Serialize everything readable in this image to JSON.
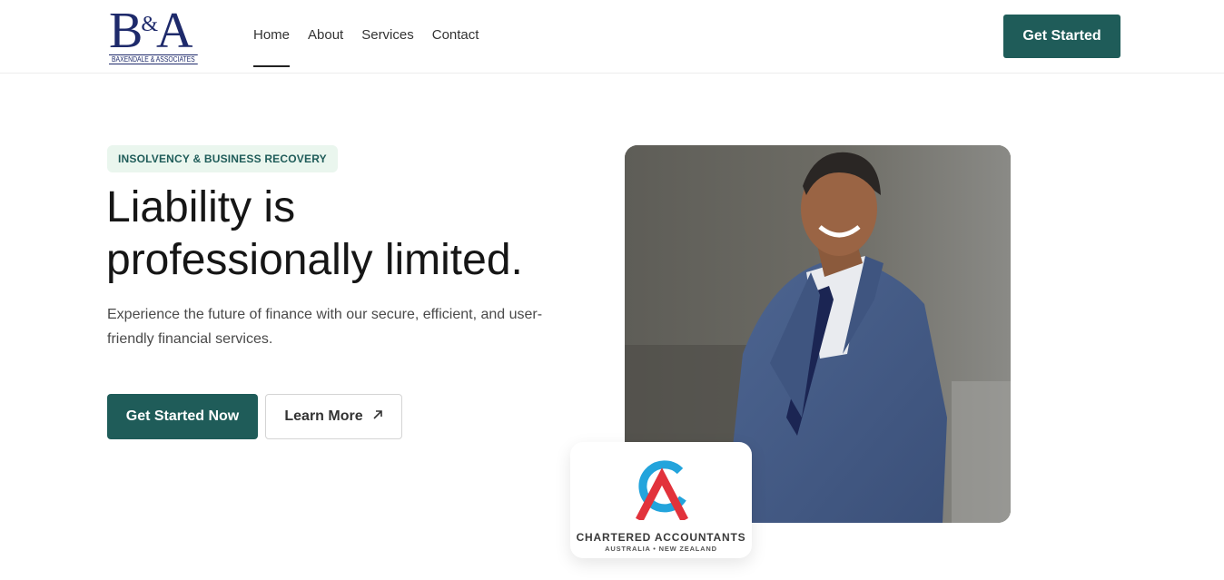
{
  "brand": {
    "logo_letters": "B&A",
    "logo_letter_b": "B",
    "logo_letter_amp": "&",
    "logo_letter_a": "A",
    "logo_sub": "BAXENDALE & ASSOCIATES",
    "color": "#1e2a6b"
  },
  "nav": {
    "items": [
      {
        "label": "Home",
        "active": true
      },
      {
        "label": "About",
        "active": false
      },
      {
        "label": "Services",
        "active": false
      },
      {
        "label": "Contact",
        "active": false
      }
    ],
    "cta_label": "Get Started"
  },
  "hero": {
    "badge": "INSOLVENCY & BUSINESS RECOVERY",
    "title_line1": "Liability is",
    "title_line2": "professionally limited.",
    "subtitle": "Experience the future of finance with our secure, efficient, and user-friendly financial services.",
    "primary_cta": "Get Started Now",
    "secondary_cta": "Learn More",
    "secondary_icon": "arrow-up-right-icon"
  },
  "accreditation": {
    "name": "CHARTERED ACCOUNTANTS",
    "region": "AUSTRALIA • NEW ZEALAND"
  },
  "colors": {
    "accent": "#1f5c59",
    "badge_bg": "#eaf6ee"
  }
}
